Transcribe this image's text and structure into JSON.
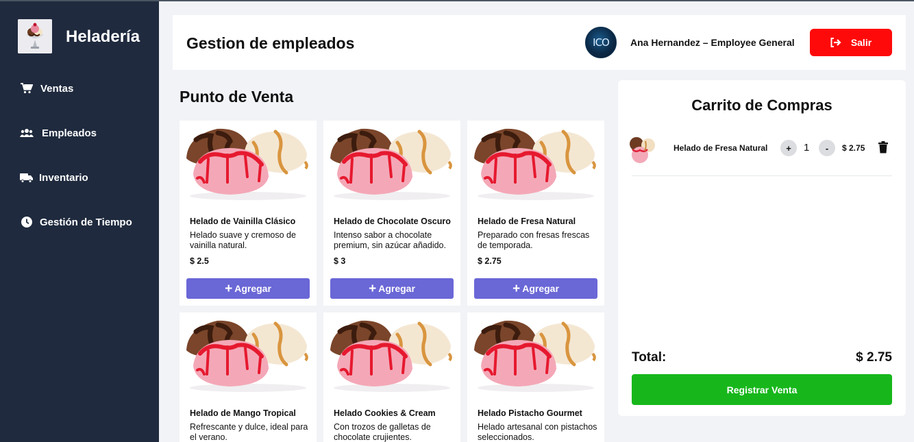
{
  "app": {
    "brand": "Heladería"
  },
  "sidebar": {
    "items": [
      {
        "label": "Ventas",
        "icon": "cart-icon"
      },
      {
        "label": "Empleados",
        "icon": "users-icon"
      },
      {
        "label": "Inventario",
        "icon": "truck-icon"
      },
      {
        "label": "Gestión de Tiempo",
        "icon": "clock-icon"
      }
    ]
  },
  "header": {
    "title": "Gestion de empleados",
    "avatar_text": "ICO",
    "user": "Ana Hernandez – Employee General",
    "logout_label": "Salir",
    "logout_color": "#ff0a0a"
  },
  "pos": {
    "title": "Punto de Venta",
    "add_label": "Agregar",
    "add_color": "#6a67d6",
    "products": [
      {
        "name": "Helado de Vainilla Clásico",
        "description": "Helado suave y cremoso de vainilla natural.",
        "price": "$ 2.5"
      },
      {
        "name": "Helado de Chocolate Oscuro",
        "description": "Intenso sabor a chocolate premium, sin azúcar añadido.",
        "price": "$ 3"
      },
      {
        "name": "Helado de Fresa Natural",
        "description": "Preparado con fresas frescas de temporada.",
        "price": "$ 2.75"
      },
      {
        "name": "Helado de Mango Tropical",
        "description": "Refrescante y dulce, ideal para el verano.",
        "price": ""
      },
      {
        "name": "Helado Cookies & Cream",
        "description": "Con trozos de galletas de chocolate crujientes.",
        "price": ""
      },
      {
        "name": "Helado Pistacho Gourmet",
        "description": "Helado artesanal con pistachos seleccionados.",
        "price": ""
      }
    ]
  },
  "cart": {
    "title": "Carrito de Compras",
    "items": [
      {
        "name": "Helado de Fresa Natural",
        "qty": "1",
        "price": "$ 2.75",
        "plus": "+",
        "minus": "-"
      }
    ],
    "total_label": "Total:",
    "total_value": "$ 2.75",
    "register_label": "Registrar Venta",
    "register_color": "#17b71b"
  }
}
